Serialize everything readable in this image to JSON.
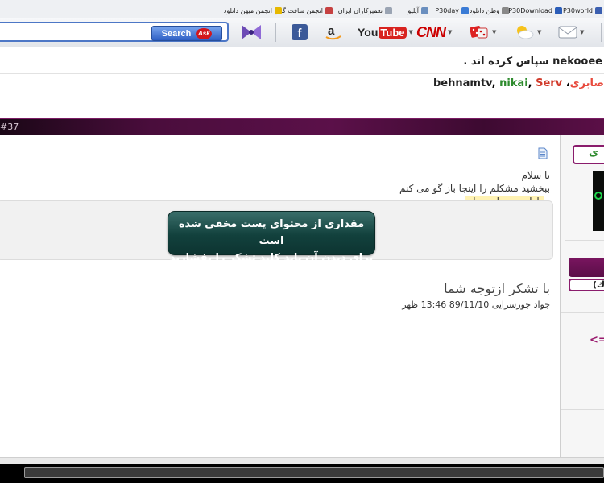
{
  "bookmarks": [
    {
      "label": "P30world",
      "icon": "p30world-icon",
      "color": "#3b5fb0"
    },
    {
      "label": "P30Download",
      "icon": "p30download-icon",
      "color": "#2b5db8"
    },
    {
      "label": "وطن دانلود",
      "icon": "vatan-download-icon",
      "color": "#888888"
    },
    {
      "label": "P30day",
      "icon": "p30day-icon",
      "color": "#3a7bd5"
    },
    {
      "label": "آپلیو",
      "icon": "aplio-icon",
      "color": "#6a8fbf"
    },
    {
      "label": "تعمیرکاران ایران",
      "icon": "page-icon",
      "color": "#9aa4b3"
    },
    {
      "label": "انجمن سافت گذر",
      "icon": "softgozar-icon",
      "color": "#c64141"
    },
    {
      "label": "انجمن میهن دانلود",
      "icon": "mihan-download-icon",
      "color": "#e6b800"
    }
  ],
  "toolbar": {
    "search_label": "Search",
    "ask_label": "Ask",
    "youtube_label": "YouTube",
    "cnn_label": "CNN",
    "icons": [
      "bow-tie-icon",
      "facebook-icon",
      "amazon-icon",
      "youtube-icon",
      "cnn-icon",
      "dice-icon",
      "weather-icon",
      "mail-icon"
    ]
  },
  "page": {
    "thanks_line": "nekooee سپاس کرده اند .",
    "names": {
      "sabri": "صابری",
      "behnamtv": "behnamtv",
      "nikai": "nikai",
      "serv": "Serv",
      "sep1": "، ",
      "sep2": ", ",
      "sep3": ", "
    },
    "post_number": "#37"
  },
  "post": {
    "greeting": "با سلام",
    "message": "ببخشید مشکلم را اینجا باز گو می کنم",
    "hidden_label": "دارای محتوای پنهان",
    "hidden_line1": "مقداری از محتوای پست مخفی شده است",
    "hidden_line2": "برای دیدن آن  باید کلید تشکر را بفشارید",
    "signature": "با تشکر ازتوجه شما",
    "signature_sub": "جواد جورسرایی 89/11/10 13:46 ظهر"
  },
  "sidebar": {
    "head_text": "ی",
    "tab_text": "(ك",
    "arrow_text": "<="
  },
  "colors": {
    "post_bar": "#4a0d3c",
    "accent_purple": "#8a1c6c",
    "name_green": "#2e8b2e",
    "name_red": "#e8493c"
  }
}
